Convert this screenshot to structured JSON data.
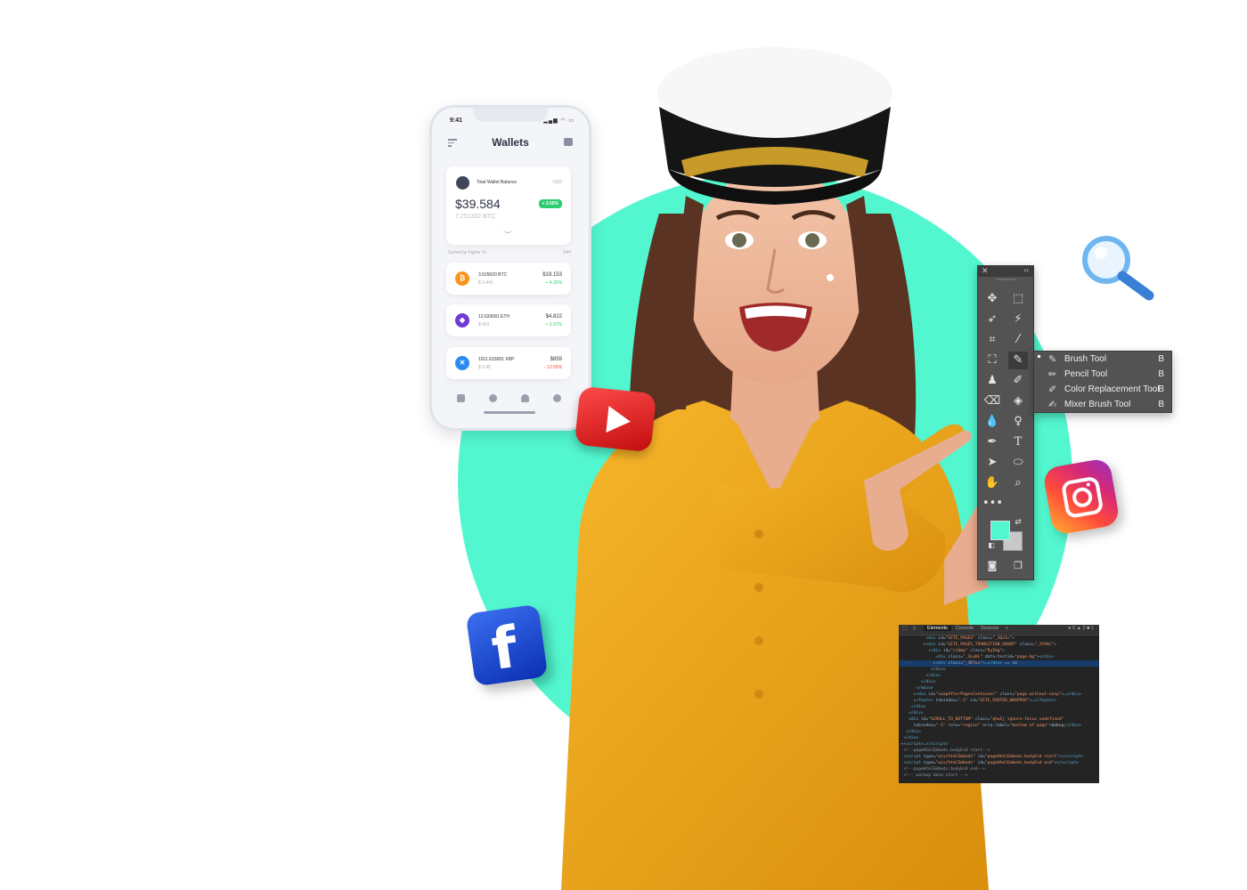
{
  "phone": {
    "status_time": "9:41",
    "title": "Wallets",
    "balance": {
      "label": "Total Wallet Balance",
      "currency": "USD",
      "amount": "$39.584",
      "btc": "7.251332 BTC",
      "change": "+ 3.55%"
    },
    "sort_label": "Sorted by higher %",
    "period": "24H",
    "coins": [
      {
        "name": "3.529020 BTC",
        "sub": "$ 5.441",
        "value": "$19.153",
        "change": "+ 4.32%",
        "color": "#f7931a",
        "symbol": "₿"
      },
      {
        "name": "12.633681 ETH",
        "sub": "$ 401",
        "value": "$4.822",
        "change": "+ 3.97%",
        "color": "#6f3cd8",
        "symbol": "◆"
      },
      {
        "name": "1911.633681 XRP",
        "sub": "$ 0.45",
        "value": "$859",
        "change": "- 13.55%",
        "color": "#2a8cf2",
        "symbol": "✕"
      }
    ]
  },
  "photoshop": {
    "flyout": [
      {
        "label": "Brush Tool",
        "key": "B"
      },
      {
        "label": "Pencil Tool",
        "key": "B"
      },
      {
        "label": "Color Replacement Tool",
        "key": "B"
      },
      {
        "label": "Mixer Brush Tool",
        "key": "B"
      }
    ],
    "foreground_color": "#52f7cf"
  },
  "devtools": {
    "tabs": [
      "Elements",
      "Console",
      "Sources",
      "»"
    ],
    "badges": "● 6 ▲ 2 ■ 1"
  },
  "colors": {
    "circle": "#52f7cf",
    "shirt": "#f2a71a"
  }
}
